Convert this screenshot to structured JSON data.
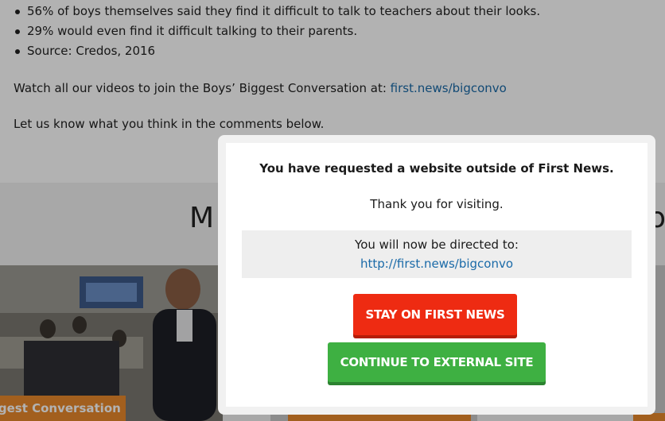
{
  "article": {
    "bullets": [
      "56% of boys themselves said they find it difficult to talk to teachers about their looks.",
      "29% would even find it difficult talking to their parents.",
      "Source: Credos, 2016"
    ],
    "watch_text": "Watch all our videos to join the Boys’ Biggest Conversation at: ",
    "watch_link": "first.news/bigconvo",
    "comment_text": "Let us know what you think in the comments below."
  },
  "related": {
    "title_left": "M",
    "title_right": "o",
    "card_1_tag": "iggest Conversation",
    "card_2_tag": "",
    "card_3_tag": ""
  },
  "modal": {
    "heading": "You have requested a website outside of First News.",
    "thanks": "Thank you for visiting.",
    "redirect_label": "You will now be directed to:",
    "redirect_url": "http://first.news/bigconvo",
    "stay_label": "STAY ON FIRST NEWS",
    "continue_label": "CONTINUE TO EXTERNAL SITE"
  },
  "colors": {
    "link": "#1a6aa8",
    "stay_button": "#ee2b12",
    "continue_button": "#3eb042",
    "card_tag": "#e8892b"
  }
}
